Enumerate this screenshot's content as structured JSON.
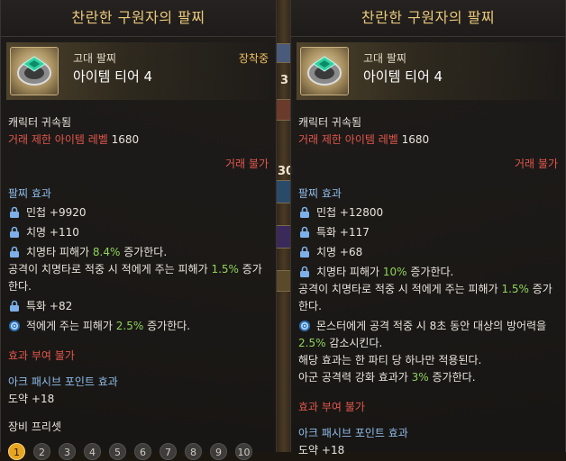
{
  "left_tooltip": {
    "title": "찬란한 구원자의 팔찌",
    "grade": "고대 팔찌",
    "tier": "아이템 티어 4",
    "equipped": "장착중",
    "bound": "캐릭터 귀속됨",
    "trade_label": "거래 제한 아이템 레벨",
    "trade_value": "1680",
    "trade_unavailable": "거래 불가",
    "section_effect": "팔찌 효과",
    "effects": [
      {
        "icon": "lock-icon",
        "text": "민첩 +9920"
      },
      {
        "icon": "lock-icon",
        "text": "치명 +110"
      },
      {
        "icon": "lock-icon",
        "pre": "치명타 피해가 ",
        "hl": "8.4%",
        "post": " 증가한다."
      },
      {
        "pre": "공격이 치명타로 적중 시 적에게 주는 피해가 ",
        "hl": "1.5%",
        "post": " 증가",
        "tail": "한다."
      },
      {
        "icon": "lock-icon",
        "text": "특화 +82"
      },
      {
        "icon": "gear-icon",
        "pre": "적에게 주는 피해가 ",
        "hl": "2.5%",
        "post": " 증가한다."
      }
    ],
    "no_effect_grant": "효과 부여 불가",
    "ark_passive_label": "아크 패시브 포인트 효과",
    "ark_passive_value": "도약 +18",
    "preset_label": "장비 프리셋",
    "presets": [
      "1",
      "2",
      "3",
      "4",
      "5",
      "6",
      "7",
      "8",
      "9",
      "10"
    ],
    "active_preset": "1"
  },
  "right_tooltip": {
    "title": "찬란한 구원자의 팔찌",
    "grade": "고대 팔찌",
    "tier": "아이템 티어 4",
    "bound": "캐릭터 귀속됨",
    "trade_label": "거래 제한 아이템 레벨",
    "trade_value": "1680",
    "trade_unavailable": "거래 불가",
    "section_effect": "팔찌 효과",
    "effects": [
      {
        "icon": "lock-icon",
        "text": "민첩 +12800"
      },
      {
        "icon": "lock-icon",
        "text": "특화 +117"
      },
      {
        "icon": "lock-icon",
        "text": "치명 +68"
      },
      {
        "icon": "lock-icon",
        "pre": "치명타 피해가 ",
        "hl": "10%",
        "post": " 증가한다."
      },
      {
        "pre": "공격이 치명타로 적중 시 적에게 주는 피해가 ",
        "hl": "1.5%",
        "post": " 증가",
        "tail": "한다."
      },
      {
        "icon": "gear-icon",
        "pre": "몬스터에게 공격 적중 시 8초 동안 대상의 방어력을",
        "hl": "2.5%",
        "post": " 감소시킨다.",
        "hl_newline": true
      },
      {
        "text": "해당 효과는 한 파티 당 하나만 적용된다."
      },
      {
        "pre": "아군 공격력 강화 효과가 ",
        "hl": "3%",
        "post": " 증가한다."
      }
    ],
    "no_effect_grant": "효과 부여 불가",
    "ark_passive_label": "아크 패시브 포인트 효과",
    "ark_passive_value": "도약 +18"
  },
  "background_digits": [
    "3",
    "30"
  ],
  "colors": {
    "title_gold": "#e9c77a",
    "equipped_gold": "#f0c060",
    "red": "#e2564c",
    "green": "#8fd25a",
    "section_blue": "#8fbcea",
    "preset_active": "#e6a520"
  }
}
